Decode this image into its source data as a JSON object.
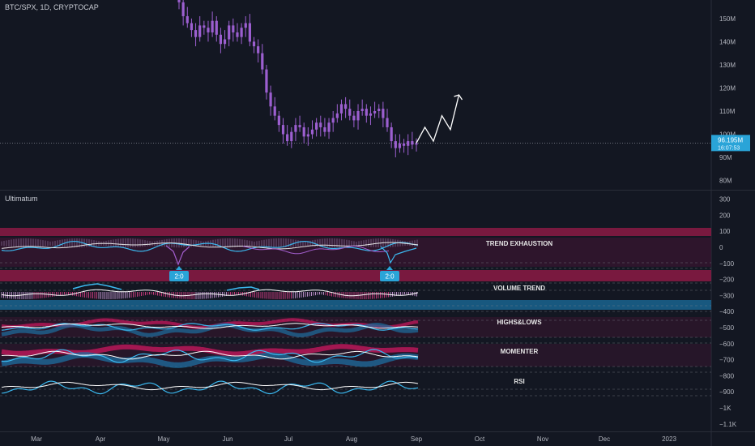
{
  "symbol_header": "BTC/SPX, 1D, CRYPTOCAP",
  "indicator_name": "Ultimatum",
  "price_axis": {
    "ticks": [
      "150M",
      "140M",
      "130M",
      "120M",
      "110M",
      "100M",
      "90M",
      "80M"
    ],
    "current_price": "96.195M",
    "countdown": "16:07:53"
  },
  "indicator_axis": {
    "ticks": [
      "300",
      "200",
      "100",
      "0",
      "−100",
      "−200",
      "−300",
      "−400",
      "−500",
      "−600",
      "−700",
      "−800",
      "−900",
      "−1K",
      "−1.1K"
    ]
  },
  "time_axis": [
    "Mar",
    "Apr",
    "May",
    "Jun",
    "Jul",
    "Aug",
    "Sep",
    "Oct",
    "Nov",
    "Dec",
    "2023"
  ],
  "panel_labels": [
    "TREND EXHAUSTION",
    "VOLUME TREND",
    "HIGHS&LOWS",
    "MOMENTER",
    "RSI"
  ],
  "signal_badges": [
    "2:0",
    "2:0"
  ],
  "colors": {
    "background": "#131722",
    "candle": "#9c5fd0",
    "price_badge": "#2aa4d8",
    "cyan": "#3bb9f0",
    "magenta": "#c2185b",
    "pink": "#e0408a",
    "band_red": "#8c1a44"
  },
  "chart_data": {
    "type": "candlestick",
    "title": "BTC/SPX, 1D, CRYPTOCAP",
    "ylim": [
      76,
      158
    ],
    "y_unit": "M",
    "x_ticks": [
      "Mar",
      "Apr",
      "May",
      "Jun",
      "Jul",
      "Aug",
      "Sep",
      "Oct",
      "Nov",
      "Dec",
      "2023"
    ],
    "series": [
      {
        "name": "BTC/SPX close (approx.)",
        "values": [
          157,
          151,
          148,
          145,
          142,
          147,
          146,
          144,
          149,
          143,
          139,
          141,
          147,
          144,
          142,
          146,
          148,
          140,
          138,
          135,
          128,
          118,
          112,
          108,
          104,
          100,
          97,
          101,
          104,
          103,
          99,
          100,
          102,
          105,
          103,
          101,
          105,
          107,
          109,
          113,
          111,
          108,
          106,
          110,
          111,
          108,
          109,
          110,
          111,
          107,
          103,
          97,
          94,
          96,
          95,
          97,
          95.5,
          96.195
        ]
      }
    ],
    "projection": {
      "name": "projected path",
      "values": [
        96.195,
        103,
        97,
        108,
        102,
        117
      ]
    },
    "current_price": 96.195
  }
}
